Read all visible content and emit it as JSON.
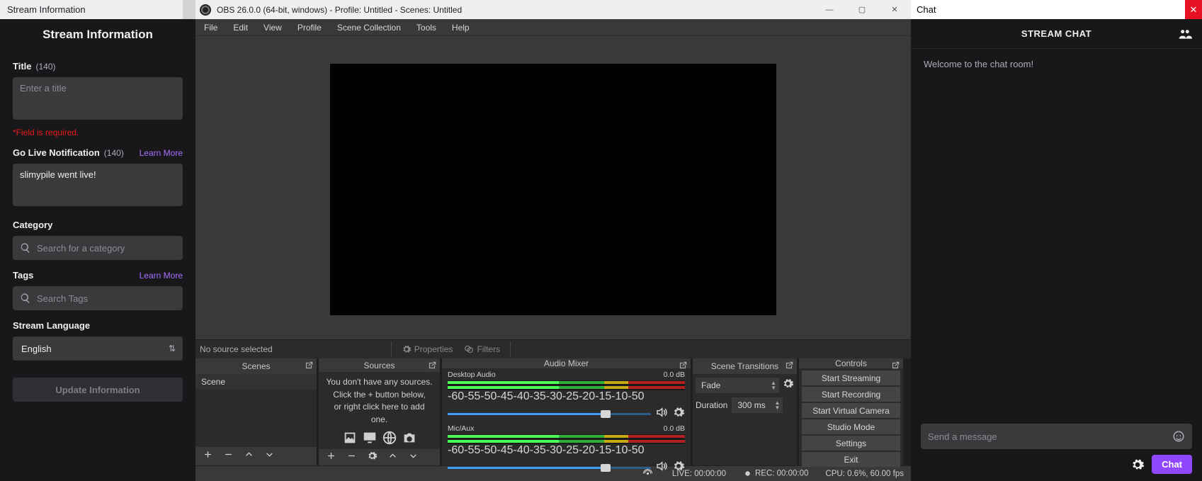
{
  "stream_info": {
    "window_title": "Stream Information",
    "heading": "Stream Information",
    "title_section": {
      "label": "Title",
      "count": "(140)",
      "placeholder": "Enter a title",
      "error": "*Field is required."
    },
    "notif_section": {
      "label": "Go Live Notification",
      "count": "(140)",
      "learn": "Learn More",
      "value": "slimypile went live!"
    },
    "category": {
      "label": "Category",
      "placeholder": "Search for a category"
    },
    "tags": {
      "label": "Tags",
      "learn": "Learn More",
      "placeholder": "Search Tags"
    },
    "language": {
      "label": "Stream Language",
      "value": "English"
    },
    "update_btn": "Update Information"
  },
  "obs": {
    "window_title": "OBS 26.0.0 (64-bit, windows) - Profile: Untitled - Scenes: Untitled",
    "menu": [
      "File",
      "Edit",
      "View",
      "Profile",
      "Scene Collection",
      "Tools",
      "Help"
    ],
    "no_source": "No source selected",
    "properties": "Properties",
    "filters": "Filters",
    "docks": {
      "scenes": {
        "title": "Scenes",
        "items": [
          "Scene"
        ]
      },
      "sources": {
        "title": "Sources",
        "empty1": "You don't have any sources.",
        "empty2": "Click the + button below,",
        "empty3": "or right click here to add one."
      },
      "mixer": {
        "title": "Audio Mixer",
        "tracks": [
          {
            "name": "Desktop Audio",
            "db": "0.0 dB"
          },
          {
            "name": "Mic/Aux",
            "db": "0.0 dB"
          }
        ],
        "ticks": [
          "-60",
          "-55",
          "-50",
          "-45",
          "-40",
          "-35",
          "-30",
          "-25",
          "-20",
          "-15",
          "-10",
          "-5",
          "0"
        ]
      },
      "transitions": {
        "title": "Scene Transitions",
        "selected": "Fade",
        "duration_label": "Duration",
        "duration_value": "300 ms"
      },
      "controls": {
        "title": "Controls",
        "buttons": [
          "Start Streaming",
          "Start Recording",
          "Start Virtual Camera",
          "Studio Mode",
          "Settings",
          "Exit"
        ]
      }
    },
    "status": {
      "live": "LIVE: 00:00:00",
      "rec": "REC: 00:00:00",
      "cpu": "CPU: 0.6%, 60.00 fps"
    }
  },
  "chat": {
    "window_title": "Chat",
    "head": "STREAM CHAT",
    "welcome": "Welcome to the chat room!",
    "placeholder": "Send a message",
    "button": "Chat"
  }
}
